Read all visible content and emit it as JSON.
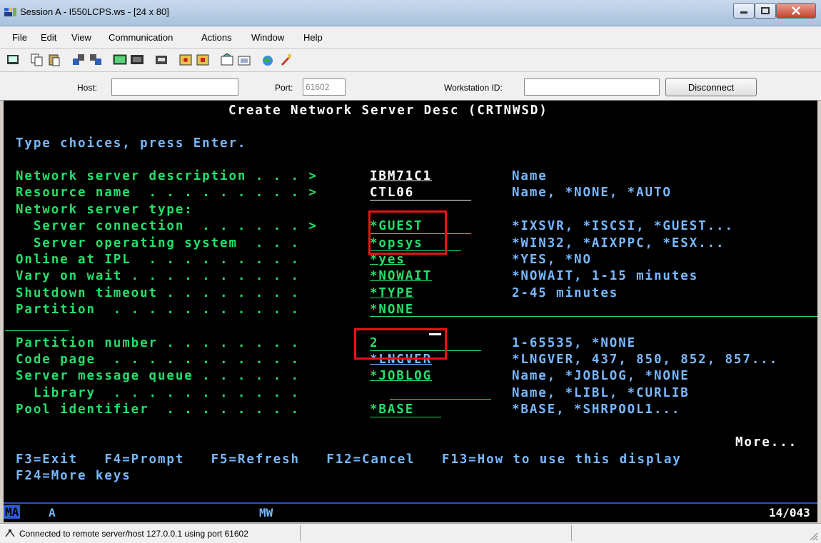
{
  "window": {
    "title": "Session A - I550LCPS.ws - [24 x 80]"
  },
  "menu": {
    "items": [
      "File",
      "Edit",
      "View",
      "Communication",
      "Actions",
      "Window",
      "Help"
    ]
  },
  "toolbar": {
    "icons": [
      "print-screen-icon",
      "copy-icon",
      "paste-icon",
      "send-icon",
      "receive-icon",
      "display-icon",
      "keypad-icon",
      "record-macro-icon",
      "play-macro-icon",
      "stop-macro-icon",
      "customize-icon",
      "settings-icon",
      "internet-icon",
      "help-icon"
    ]
  },
  "connection": {
    "host_label": "Host:",
    "host_value": "",
    "port_label": "Port:",
    "port_value": "61602",
    "workstation_label": "Workstation ID:",
    "workstation_value": "",
    "disconnect_label": "Disconnect"
  },
  "screen": {
    "title": "Create Network Server Desc (CRTNWSD)",
    "instruction": "Type choices, press Enter.",
    "rows": [
      {
        "label": "Network server description . . . > ",
        "value": "IBM71C1",
        "hint": "Name"
      },
      {
        "label": "Resource name  . . . . . . . . . > ",
        "value": "CTL06",
        "hint": "Name, *NONE, *AUTO"
      },
      {
        "label": "Network server type:",
        "value": "",
        "hint": ""
      },
      {
        "label": "  Server connection  . . . . . . > ",
        "value": "*GUEST",
        "hint": "*IXSVR, *ISCSI, *GUEST..."
      },
      {
        "label": "  Server operating system  . . . ",
        "value": "*opsys",
        "hint": "*WIN32, *AIXPPC, *ESX..."
      },
      {
        "label": "Online at IPL  . . . . . . . . . ",
        "value": "*yes",
        "hint": "*YES, *NO"
      },
      {
        "label": "Vary on wait . . . . . . . . . . ",
        "value": "*NOWAIT",
        "hint": "*NOWAIT, 1-15 minutes"
      },
      {
        "label": "Shutdown timeout . . . . . . . . ",
        "value": "*TYPE",
        "hint": "2-45 minutes"
      },
      {
        "label": "Partition  . . . . . . . . . . . ",
        "value": "*NONE",
        "hint": ""
      },
      {
        "label": "Partition number . . . . . . . . ",
        "value": "2",
        "hint": "1-65535, *NONE"
      },
      {
        "label": "Code page  . . . . . . . . . . . ",
        "value": "*LNGVER",
        "hint": "*LNGVER, 437, 850, 852, 857..."
      },
      {
        "label": "Server message queue . . . . . . ",
        "value": "*JOBLOG",
        "hint": "Name, *JOBLOG, *NONE"
      },
      {
        "label": "  Library  . . . . . . . . . . . ",
        "value": "",
        "hint": "Name, *LIBL, *CURLIB"
      },
      {
        "label": "Pool identifier  . . . . . . . . ",
        "value": "*BASE",
        "hint": "*BASE, *SHRPOOL1..."
      }
    ],
    "more": "More...",
    "fkeys_line1": "F3=Exit   F4=Prompt   F5=Refresh   F12=Cancel   F13=How to use this display",
    "fkeys_line2": "F24=More keys"
  },
  "oia": {
    "session": "MA",
    "a": "A",
    "mw": "MW",
    "cursor_position": "14/043"
  },
  "status": {
    "text": "Connected to remote server/host 127.0.0.1 using port 61602"
  }
}
